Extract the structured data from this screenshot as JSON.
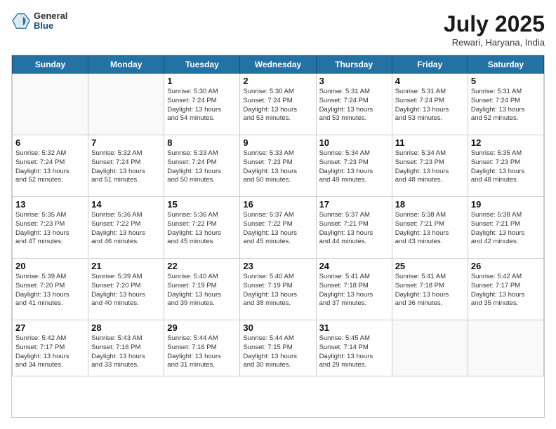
{
  "header": {
    "logo_general": "General",
    "logo_blue": "Blue",
    "month_title": "July 2025",
    "location": "Rewari, Haryana, India"
  },
  "days_of_week": [
    "Sunday",
    "Monday",
    "Tuesday",
    "Wednesday",
    "Thursday",
    "Friday",
    "Saturday"
  ],
  "weeks": [
    [
      {
        "day": "",
        "info": ""
      },
      {
        "day": "",
        "info": ""
      },
      {
        "day": "1",
        "info": "Sunrise: 5:30 AM\nSunset: 7:24 PM\nDaylight: 13 hours\nand 54 minutes."
      },
      {
        "day": "2",
        "info": "Sunrise: 5:30 AM\nSunset: 7:24 PM\nDaylight: 13 hours\nand 53 minutes."
      },
      {
        "day": "3",
        "info": "Sunrise: 5:31 AM\nSunset: 7:24 PM\nDaylight: 13 hours\nand 53 minutes."
      },
      {
        "day": "4",
        "info": "Sunrise: 5:31 AM\nSunset: 7:24 PM\nDaylight: 13 hours\nand 53 minutes."
      },
      {
        "day": "5",
        "info": "Sunrise: 5:31 AM\nSunset: 7:24 PM\nDaylight: 13 hours\nand 52 minutes."
      }
    ],
    [
      {
        "day": "6",
        "info": "Sunrise: 5:32 AM\nSunset: 7:24 PM\nDaylight: 13 hours\nand 52 minutes."
      },
      {
        "day": "7",
        "info": "Sunrise: 5:32 AM\nSunset: 7:24 PM\nDaylight: 13 hours\nand 51 minutes."
      },
      {
        "day": "8",
        "info": "Sunrise: 5:33 AM\nSunset: 7:24 PM\nDaylight: 13 hours\nand 50 minutes."
      },
      {
        "day": "9",
        "info": "Sunrise: 5:33 AM\nSunset: 7:23 PM\nDaylight: 13 hours\nand 50 minutes."
      },
      {
        "day": "10",
        "info": "Sunrise: 5:34 AM\nSunset: 7:23 PM\nDaylight: 13 hours\nand 49 minutes."
      },
      {
        "day": "11",
        "info": "Sunrise: 5:34 AM\nSunset: 7:23 PM\nDaylight: 13 hours\nand 48 minutes."
      },
      {
        "day": "12",
        "info": "Sunrise: 5:35 AM\nSunset: 7:23 PM\nDaylight: 13 hours\nand 48 minutes."
      }
    ],
    [
      {
        "day": "13",
        "info": "Sunrise: 5:35 AM\nSunset: 7:23 PM\nDaylight: 13 hours\nand 47 minutes."
      },
      {
        "day": "14",
        "info": "Sunrise: 5:36 AM\nSunset: 7:22 PM\nDaylight: 13 hours\nand 46 minutes."
      },
      {
        "day": "15",
        "info": "Sunrise: 5:36 AM\nSunset: 7:22 PM\nDaylight: 13 hours\nand 45 minutes."
      },
      {
        "day": "16",
        "info": "Sunrise: 5:37 AM\nSunset: 7:22 PM\nDaylight: 13 hours\nand 45 minutes."
      },
      {
        "day": "17",
        "info": "Sunrise: 5:37 AM\nSunset: 7:21 PM\nDaylight: 13 hours\nand 44 minutes."
      },
      {
        "day": "18",
        "info": "Sunrise: 5:38 AM\nSunset: 7:21 PM\nDaylight: 13 hours\nand 43 minutes."
      },
      {
        "day": "19",
        "info": "Sunrise: 5:38 AM\nSunset: 7:21 PM\nDaylight: 13 hours\nand 42 minutes."
      }
    ],
    [
      {
        "day": "20",
        "info": "Sunrise: 5:39 AM\nSunset: 7:20 PM\nDaylight: 13 hours\nand 41 minutes."
      },
      {
        "day": "21",
        "info": "Sunrise: 5:39 AM\nSunset: 7:20 PM\nDaylight: 13 hours\nand 40 minutes."
      },
      {
        "day": "22",
        "info": "Sunrise: 5:40 AM\nSunset: 7:19 PM\nDaylight: 13 hours\nand 39 minutes."
      },
      {
        "day": "23",
        "info": "Sunrise: 5:40 AM\nSunset: 7:19 PM\nDaylight: 13 hours\nand 38 minutes."
      },
      {
        "day": "24",
        "info": "Sunrise: 5:41 AM\nSunset: 7:18 PM\nDaylight: 13 hours\nand 37 minutes."
      },
      {
        "day": "25",
        "info": "Sunrise: 5:41 AM\nSunset: 7:18 PM\nDaylight: 13 hours\nand 36 minutes."
      },
      {
        "day": "26",
        "info": "Sunrise: 5:42 AM\nSunset: 7:17 PM\nDaylight: 13 hours\nand 35 minutes."
      }
    ],
    [
      {
        "day": "27",
        "info": "Sunrise: 5:42 AM\nSunset: 7:17 PM\nDaylight: 13 hours\nand 34 minutes."
      },
      {
        "day": "28",
        "info": "Sunrise: 5:43 AM\nSunset: 7:16 PM\nDaylight: 13 hours\nand 33 minutes."
      },
      {
        "day": "29",
        "info": "Sunrise: 5:44 AM\nSunset: 7:16 PM\nDaylight: 13 hours\nand 31 minutes."
      },
      {
        "day": "30",
        "info": "Sunrise: 5:44 AM\nSunset: 7:15 PM\nDaylight: 13 hours\nand 30 minutes."
      },
      {
        "day": "31",
        "info": "Sunrise: 5:45 AM\nSunset: 7:14 PM\nDaylight: 13 hours\nand 29 minutes."
      },
      {
        "day": "",
        "info": ""
      },
      {
        "day": "",
        "info": ""
      }
    ]
  ]
}
